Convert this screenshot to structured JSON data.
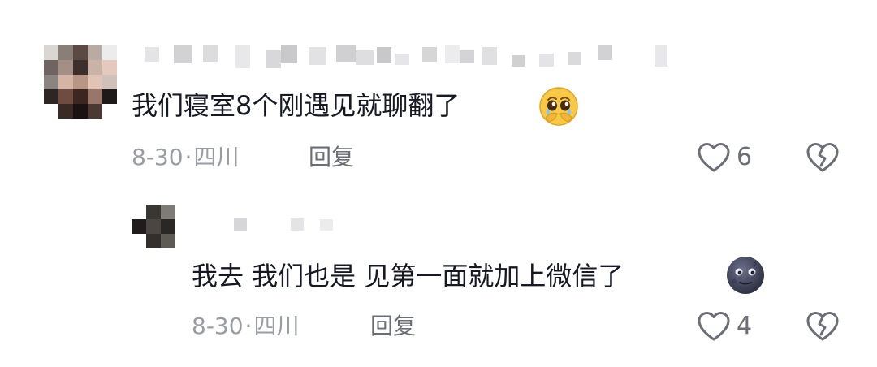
{
  "comments": [
    {
      "text": "我们寝室8个刚遇见就聊翻了",
      "emoji_icon": "pleading-face-crying-emoji",
      "date": "8-30",
      "dot": "·",
      "location": "四川",
      "reply_label": "回复",
      "likes": "6",
      "like_icon": "heart-outline-icon",
      "dislike_icon": "broken-heart-icon"
    },
    {
      "text": "我去 我们也是 见第一面就加上微信了",
      "emoji_icon": "new-moon-face-emoji",
      "date": "8-30",
      "dot": "·",
      "location": "四川",
      "reply_label": "回复",
      "likes": "4",
      "like_icon": "heart-outline-icon",
      "dislike_icon": "broken-heart-icon"
    }
  ],
  "colors": {
    "text": "#161823",
    "meta": "#9a9ca3",
    "action": "#6b6e76"
  }
}
